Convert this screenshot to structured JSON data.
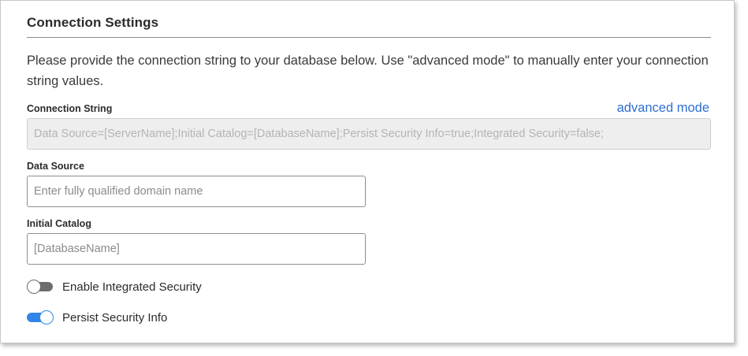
{
  "section": {
    "title": "Connection Settings",
    "description": "Please provide the connection string to your database below. Use \"advanced mode\" to manually enter your connection string values."
  },
  "connection_string": {
    "label": "Connection String",
    "advanced_link": "advanced mode",
    "value": "Data Source=[ServerName];Initial Catalog=[DatabaseName];Persist Security Info=true;Integrated Security=false;"
  },
  "data_source": {
    "label": "Data Source",
    "value": "",
    "placeholder": "Enter fully qualified domain name"
  },
  "initial_catalog": {
    "label": "Initial Catalog",
    "value": "",
    "placeholder": "[DatabaseName]"
  },
  "toggles": {
    "integrated_security": {
      "label": "Enable Integrated Security",
      "enabled": false
    },
    "persist_security_info": {
      "label": "Persist Security Info",
      "enabled": true
    }
  },
  "colors": {
    "accent": "#2f86e8",
    "link": "#2e6fd1",
    "toggle_off": "#6d6d6d"
  }
}
